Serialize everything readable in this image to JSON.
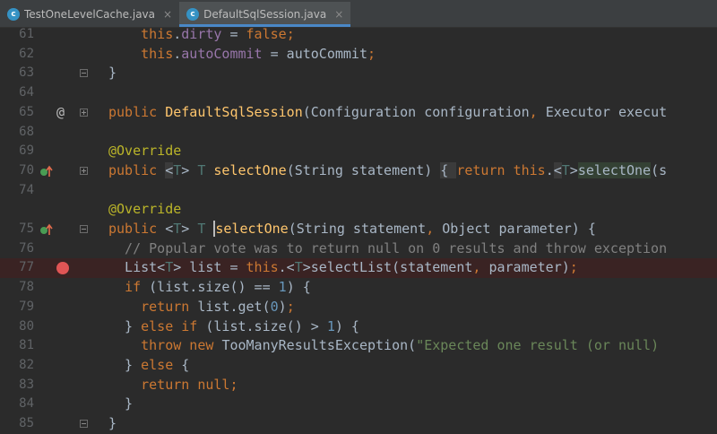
{
  "tabs": [
    {
      "label": "TestOneLevelCache.java",
      "icon": "class-icon",
      "icon_glyph": "c",
      "active": false,
      "close": "×"
    },
    {
      "label": "DefaultSqlSession.java",
      "icon": "class-icon",
      "icon_glyph": "c",
      "active": true,
      "close": "×"
    }
  ],
  "lines": [
    {
      "n": "61",
      "tokens": [
        [
          "    ",
          ""
        ],
        [
          "this",
          ".kw"
        ],
        [
          ".",
          ""
        ],
        [
          "dirty",
          "fld"
        ],
        [
          " = ",
          ""
        ],
        [
          "false",
          "kw"
        ],
        [
          ";",
          "kw"
        ]
      ]
    },
    {
      "n": "62",
      "tokens": [
        [
          "    ",
          ""
        ],
        [
          "this",
          "kw"
        ],
        [
          ".",
          ""
        ],
        [
          "autoCommit",
          "fld"
        ],
        [
          " = autoCommit",
          ""
        ],
        [
          ";",
          "kw"
        ]
      ]
    },
    {
      "n": "63",
      "tokens": [
        [
          "}",
          ""
        ]
      ]
    },
    {
      "n": "64",
      "tokens": []
    },
    {
      "n": "65",
      "tokens": [
        [
          "public ",
          "kw"
        ],
        [
          "DefaultSqlSession",
          "mth"
        ],
        [
          "(Configuration configuration",
          ""
        ],
        [
          ", ",
          "kw"
        ],
        [
          "Executor execut",
          ""
        ]
      ]
    },
    {
      "n": "68",
      "tokens": []
    },
    {
      "n": "69",
      "tokens": [
        [
          "@Override",
          "ann"
        ]
      ]
    },
    {
      "n": "70",
      "tokens": [
        [
          "public ",
          "kw"
        ],
        [
          "<",
          "fbox"
        ],
        [
          "T",
          "tp"
        ],
        [
          "> ",
          ""
        ],
        [
          "T ",
          "tp"
        ],
        [
          "selectOne",
          "mth"
        ],
        [
          "(String statement) ",
          ""
        ],
        [
          "{ ",
          "fbox"
        ],
        [
          "return ",
          "kw"
        ],
        [
          "this",
          "kw"
        ],
        [
          ".",
          ""
        ],
        [
          "<",
          "fbox"
        ],
        [
          "T",
          "tp"
        ],
        [
          ">",
          ""
        ],
        [
          "selectOne",
          "hl"
        ],
        [
          "(s",
          ""
        ]
      ]
    },
    {
      "n": "74",
      "tokens": []
    },
    {
      "n": "74b",
      "tokens": [
        [
          "@Override",
          "ann"
        ]
      ]
    },
    {
      "n": "75",
      "tokens": [
        [
          "public ",
          "kw"
        ],
        [
          "<",
          ""
        ],
        [
          "T",
          "tp"
        ],
        [
          "> ",
          ""
        ],
        [
          "T ",
          "tp"
        ],
        [
          "selectOne",
          "mth"
        ],
        [
          "(String statement",
          ""
        ],
        [
          ", ",
          "kw"
        ],
        [
          "Object parameter) {",
          ""
        ]
      ]
    },
    {
      "n": "76",
      "tokens": [
        [
          "  // Popular vote was to return null on 0 results and throw exception",
          "cmt"
        ]
      ]
    },
    {
      "n": "77",
      "tokens": [
        [
          "  List<",
          ""
        ],
        [
          "T",
          "tp"
        ],
        [
          "> list = ",
          ""
        ],
        [
          "this",
          "kw"
        ],
        [
          ".<",
          ""
        ],
        [
          "T",
          "tp"
        ],
        [
          ">selectList(statement",
          ""
        ],
        [
          ", ",
          "kw"
        ],
        [
          "parameter)",
          ""
        ],
        [
          ";",
          "kw"
        ]
      ]
    },
    {
      "n": "78",
      "tokens": [
        [
          "  ",
          ""
        ],
        [
          "if ",
          "kw"
        ],
        [
          "(list.size() == ",
          ""
        ],
        [
          "1",
          "num"
        ],
        [
          ") {",
          ""
        ]
      ]
    },
    {
      "n": "79",
      "tokens": [
        [
          "    ",
          ""
        ],
        [
          "return ",
          "kw"
        ],
        [
          "list.get(",
          ""
        ],
        [
          "0",
          "num"
        ],
        [
          ")",
          ""
        ],
        [
          ";",
          "kw"
        ]
      ]
    },
    {
      "n": "80",
      "tokens": [
        [
          "  } ",
          ""
        ],
        [
          "else if ",
          "kw"
        ],
        [
          "(list.size() > ",
          ""
        ],
        [
          "1",
          "num"
        ],
        [
          ") {",
          ""
        ]
      ]
    },
    {
      "n": "81",
      "tokens": [
        [
          "    ",
          ""
        ],
        [
          "throw new ",
          "kw"
        ],
        [
          "TooManyResultsException(",
          ""
        ],
        [
          "\"Expected one result (or null)",
          "str"
        ]
      ]
    },
    {
      "n": "82",
      "tokens": [
        [
          "  } ",
          ""
        ],
        [
          "else ",
          "kw"
        ],
        [
          "{",
          ""
        ]
      ]
    },
    {
      "n": "83",
      "tokens": [
        [
          "    ",
          ""
        ],
        [
          "return null",
          "kw"
        ],
        [
          ";",
          "kw"
        ]
      ]
    },
    {
      "n": "84",
      "tokens": [
        [
          "  }",
          ""
        ]
      ]
    },
    {
      "n": "85",
      "tokens": [
        [
          "}",
          ""
        ]
      ]
    }
  ],
  "line_numbers": [
    "61",
    "62",
    "63",
    "64",
    "65",
    "68",
    "69",
    "70",
    "74",
    "",
    "75",
    "76",
    "77",
    "78",
    "79",
    "80",
    "81",
    "82",
    "83",
    "84",
    "85"
  ],
  "gutter": {
    "at_icon": "@",
    "override_icon": "override-up-arrow-icon",
    "breakpoint_icon": "breakpoint-icon"
  },
  "colors": {
    "background": "#2b2b2b",
    "keyword": "#cc7832",
    "annotation": "#bbb529",
    "field": "#9876aa",
    "string": "#6a8759",
    "number": "#6897bb",
    "comment": "#808080",
    "method": "#ffc66d",
    "breakpoint": "#e05555",
    "active_tab_underline": "#4a88c7"
  }
}
